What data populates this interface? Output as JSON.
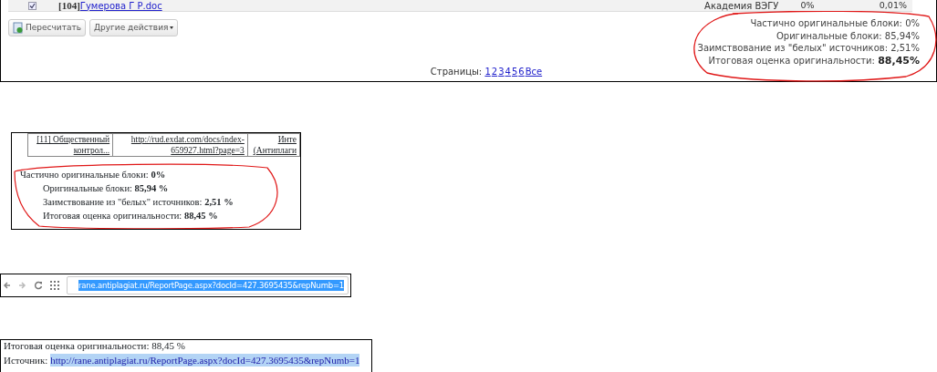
{
  "report_panel": {
    "table_row": {
      "checked": true,
      "file": "[104]",
      "file_link": "Гумерова Г Р.doc",
      "source": "Академия ВЭГУ",
      "column_3": "0%",
      "column_4": "0,01%"
    },
    "buttons": [
      {
        "kind": "recalc",
        "label": "Пересчитать"
      },
      {
        "kind": "dropdown",
        "label": "Другие действия"
      }
    ],
    "stats": [
      {
        "label": "Частично оригинальные блоки: ",
        "value": "0%",
        "bold": false
      },
      {
        "label": "Оригинальные блоки: ",
        "value": "85,94%",
        "bold": false
      },
      {
        "label": "Заимствование из \"белых\" источников: ",
        "value": "2,51%",
        "bold": false
      },
      {
        "label": "Итоговая оценка оригинальности: ",
        "value": "88,45%",
        "bold": true
      }
    ],
    "pages_label": "Страницы: ",
    "pages": [
      "1",
      "2",
      "3",
      "4",
      "5",
      "6",
      "Все"
    ]
  },
  "document_panel": {
    "table_row": [
      "[11] Общественный контрол...",
      "http://rud.exdat.com/docs/index-659927.html?page=3",
      "Инте (Антиплаги"
    ],
    "stats": [
      "Частично оригинальные блоки: **0%**",
      "Оригинальные блоки: **85,94 %**",
      "Заимствование из \"белых\" источников: **2,51 %**",
      "Итоговая оценка оригинальности: **88,45 %**"
    ]
  },
  "browser_bar": {
    "url": "rane.antiplagiat.ru/ReportPage.aspx?docId=427.3695435&repNumb=1",
    "selected": true
  },
  "source_panel": {
    "cut_line": "Итоговая оценка оригинальности: 88,45 %",
    "label": "Источник: ",
    "link": "http://rane.antiplagiat.ru/ReportPage.aspx?docId=427.3695435&repNumb=1",
    "selected": true
  }
}
